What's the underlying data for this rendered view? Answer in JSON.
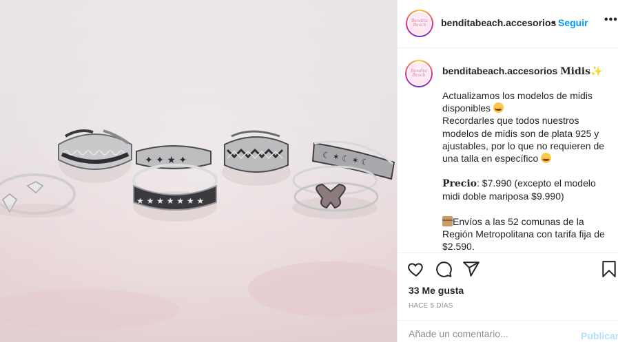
{
  "post": {
    "username": "benditabeach.accesorios",
    "dot": "•",
    "follow_label": "Seguir",
    "more_label": "•••",
    "avatar_logo_text": "Bendita Beach"
  },
  "caption": {
    "username": "benditabeach.accesorios",
    "title": "Midis",
    "title_emoji": "✨",
    "line1": "Actualizamos los modelos de midis disponibles",
    "line2": "Recordarles que todos nuestros modelos de midis son de plata 925 y ajustables, por lo que no requieren de una talla en específico",
    "price_label": "Precio",
    "price_text": ": $7.990 (excepto el modelo midi doble mariposa $9.990)",
    "shipping_text": "Envíos a las 52 comunas de la Región Metropolitana con tarifa fija de $2.590."
  },
  "actions": {
    "like": "heart-icon",
    "comment": "comment-icon",
    "share": "share-icon",
    "save": "bookmark-icon"
  },
  "likes": "33 Me gusta",
  "time_ago": "HACE 5 DÍAS",
  "comment": {
    "placeholder": "Añade un comentario...",
    "publish_label": "Publicar"
  },
  "colors": {
    "accent": "#0095f6",
    "publish_disabled": "#b2dffc",
    "text": "#262626",
    "muted": "#8e8e8e",
    "border": "#efefef"
  }
}
